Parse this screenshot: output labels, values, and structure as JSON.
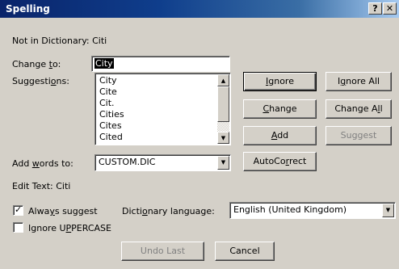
{
  "window": {
    "title": "Spelling",
    "help_btn": "?",
    "close_btn": "✕"
  },
  "not_in_dictionary": "Not in Dictionary: Citi",
  "change_to": {
    "label_pre": "Change ",
    "label_u": "t",
    "label_post": "o:",
    "value": "City"
  },
  "suggestions": {
    "label_pre": "Suggesti",
    "label_u": "o",
    "label_post": "ns:",
    "items": [
      "City",
      "Cite",
      "Cit.",
      "Cities",
      "Cites",
      "Cited"
    ]
  },
  "buttons": {
    "ignore": {
      "u": "I",
      "rest": "gnore"
    },
    "ignore_all": {
      "pre": "I",
      "u": "g",
      "post": "nore All"
    },
    "change": {
      "u": "C",
      "rest": "hange"
    },
    "change_all": {
      "pre": "Change A",
      "u": "l",
      "post": "l"
    },
    "add": {
      "u": "A",
      "rest": "dd"
    },
    "suggest": "Suggest",
    "autocorrect": {
      "pre": "AutoCo",
      "u": "r",
      "post": "rect"
    },
    "undo_last": "Undo Last",
    "cancel": "Cancel"
  },
  "add_words_to": {
    "label_pre": "Add ",
    "label_u": "w",
    "label_post": "ords to:",
    "value": "CUSTOM.DIC"
  },
  "edit_text": "Edit Text: Citi",
  "always_suggest": {
    "pre": "Alwa",
    "u": "y",
    "post": "s suggest",
    "checked": true
  },
  "dictionary_language": {
    "label_pre": "Dicti",
    "label_u": "o",
    "label_post": "nary language:",
    "value": "English (United Kingdom)"
  },
  "ignore_uppercase": {
    "pre": "Ignore U",
    "u": "P",
    "post": "PERCASE",
    "checked": false
  }
}
